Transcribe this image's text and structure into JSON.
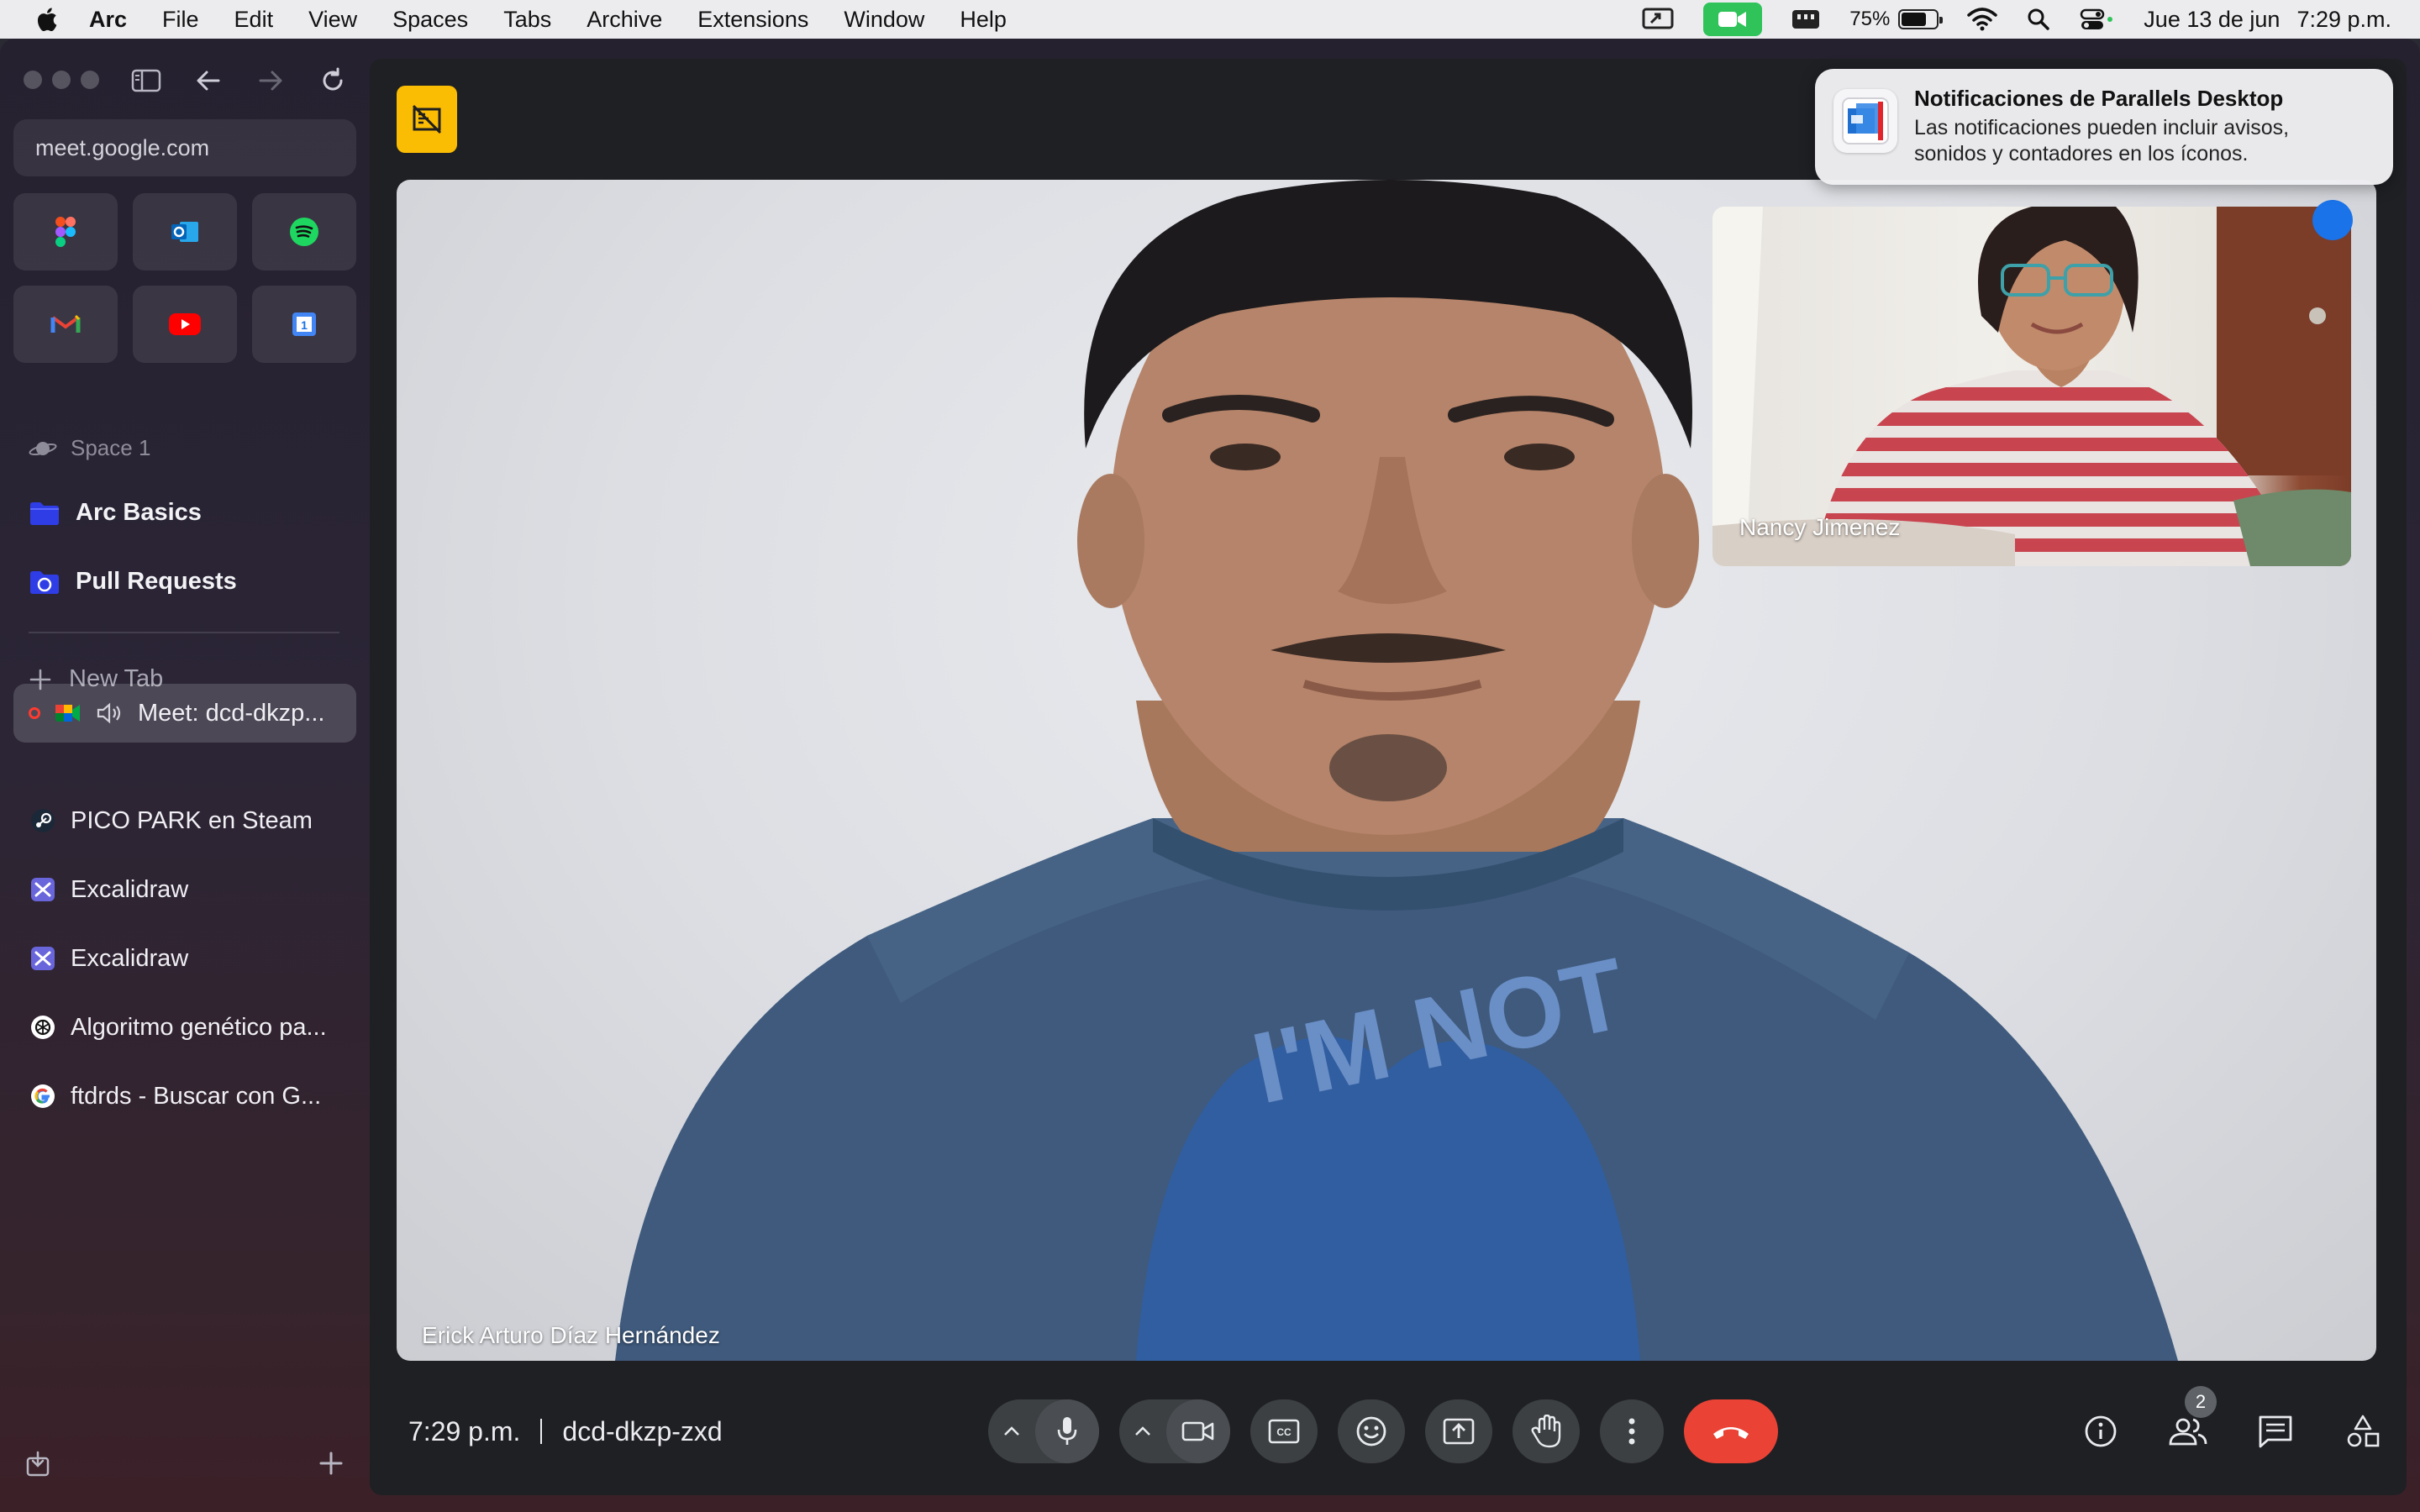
{
  "menubar": {
    "app_name": "Arc",
    "items": [
      "File",
      "Edit",
      "View",
      "Spaces",
      "Tabs",
      "Archive",
      "Extensions",
      "Window",
      "Help"
    ],
    "battery_percent": "75%",
    "date": "Jue 13 de jun",
    "time": "7:29 p.m."
  },
  "sidebar": {
    "url": "meet.google.com",
    "favorites": [
      "figma-icon",
      "outlook-icon",
      "spotify-icon",
      "gmail-icon",
      "youtube-icon",
      "google-calendar-icon"
    ],
    "space_label": "Space 1",
    "folders": [
      {
        "label": "Arc Basics"
      },
      {
        "label": "Pull Requests"
      }
    ],
    "new_tab_label": "New Tab",
    "tabs": [
      {
        "label": "Meet: dcd-dkzp...",
        "active": true
      },
      {
        "label": "PICO PARK en Steam"
      },
      {
        "label": "Excalidraw"
      },
      {
        "label": "Excalidraw"
      },
      {
        "label": "Algoritmo genético pa..."
      },
      {
        "label": "ftdrds - Buscar con G..."
      }
    ]
  },
  "notification": {
    "title": "Notificaciones de Parallels Desktop",
    "body_line1": "Las notificaciones pueden incluir avisos,",
    "body_line2": "sonidos y contadores en los íconos."
  },
  "meet": {
    "main_participant": "Erick Arturo Díaz Hernández",
    "pip_participant": "Nancy Jimenez",
    "time": "7:29 p.m.",
    "meeting_code": "dcd-dkzp-zxd",
    "participant_count": "2"
  },
  "colors": {
    "hangup": "#ea4335",
    "camera_indicator": "#2fc35a",
    "badge": "#fbbc04",
    "control_bg": "#3c4043"
  }
}
